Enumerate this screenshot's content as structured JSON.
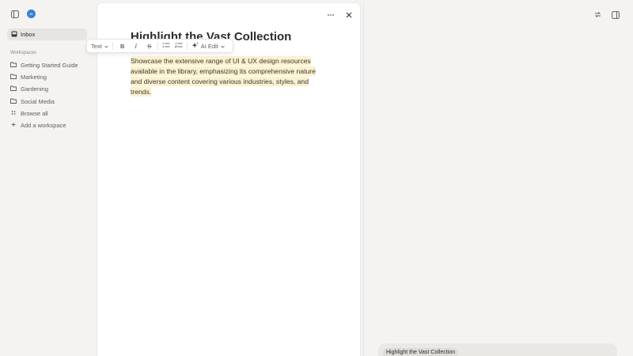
{
  "sidebar": {
    "avatar_initials": "JK",
    "inbox_label": "Inbox",
    "section_label": "Workspaces",
    "items": [
      {
        "label": "Getting Started Guide",
        "icon": "folder-icon"
      },
      {
        "label": "Marketing",
        "icon": "folder-icon"
      },
      {
        "label": "Gardening",
        "icon": "folder-icon"
      },
      {
        "label": "Social Media",
        "icon": "folder-icon"
      },
      {
        "label": "Browse all",
        "icon": "grid-icon"
      },
      {
        "label": "Add a workspace",
        "icon": "plus-icon"
      }
    ]
  },
  "document": {
    "title": "Highlight the Vast Collection",
    "body": "Showcase the extensive range of UI & UX design resources available in the library, emphasizing its comprehensive nature and diverse content covering various industries, styles, and trends.",
    "highlight_color": "#fcf1cf",
    "more_icon": "more-horizontal-icon",
    "close_icon": "close-icon"
  },
  "toolbar": {
    "text_label": "Text",
    "bold_label": "B",
    "italic_label": "I",
    "strike_label": "S",
    "ai_label": "AI Edit"
  },
  "right_panel": {
    "chip_label": "Highlight the Vast Collection"
  },
  "colors": {
    "background": "#f4f3f1",
    "accent": "#3b7fd4"
  }
}
